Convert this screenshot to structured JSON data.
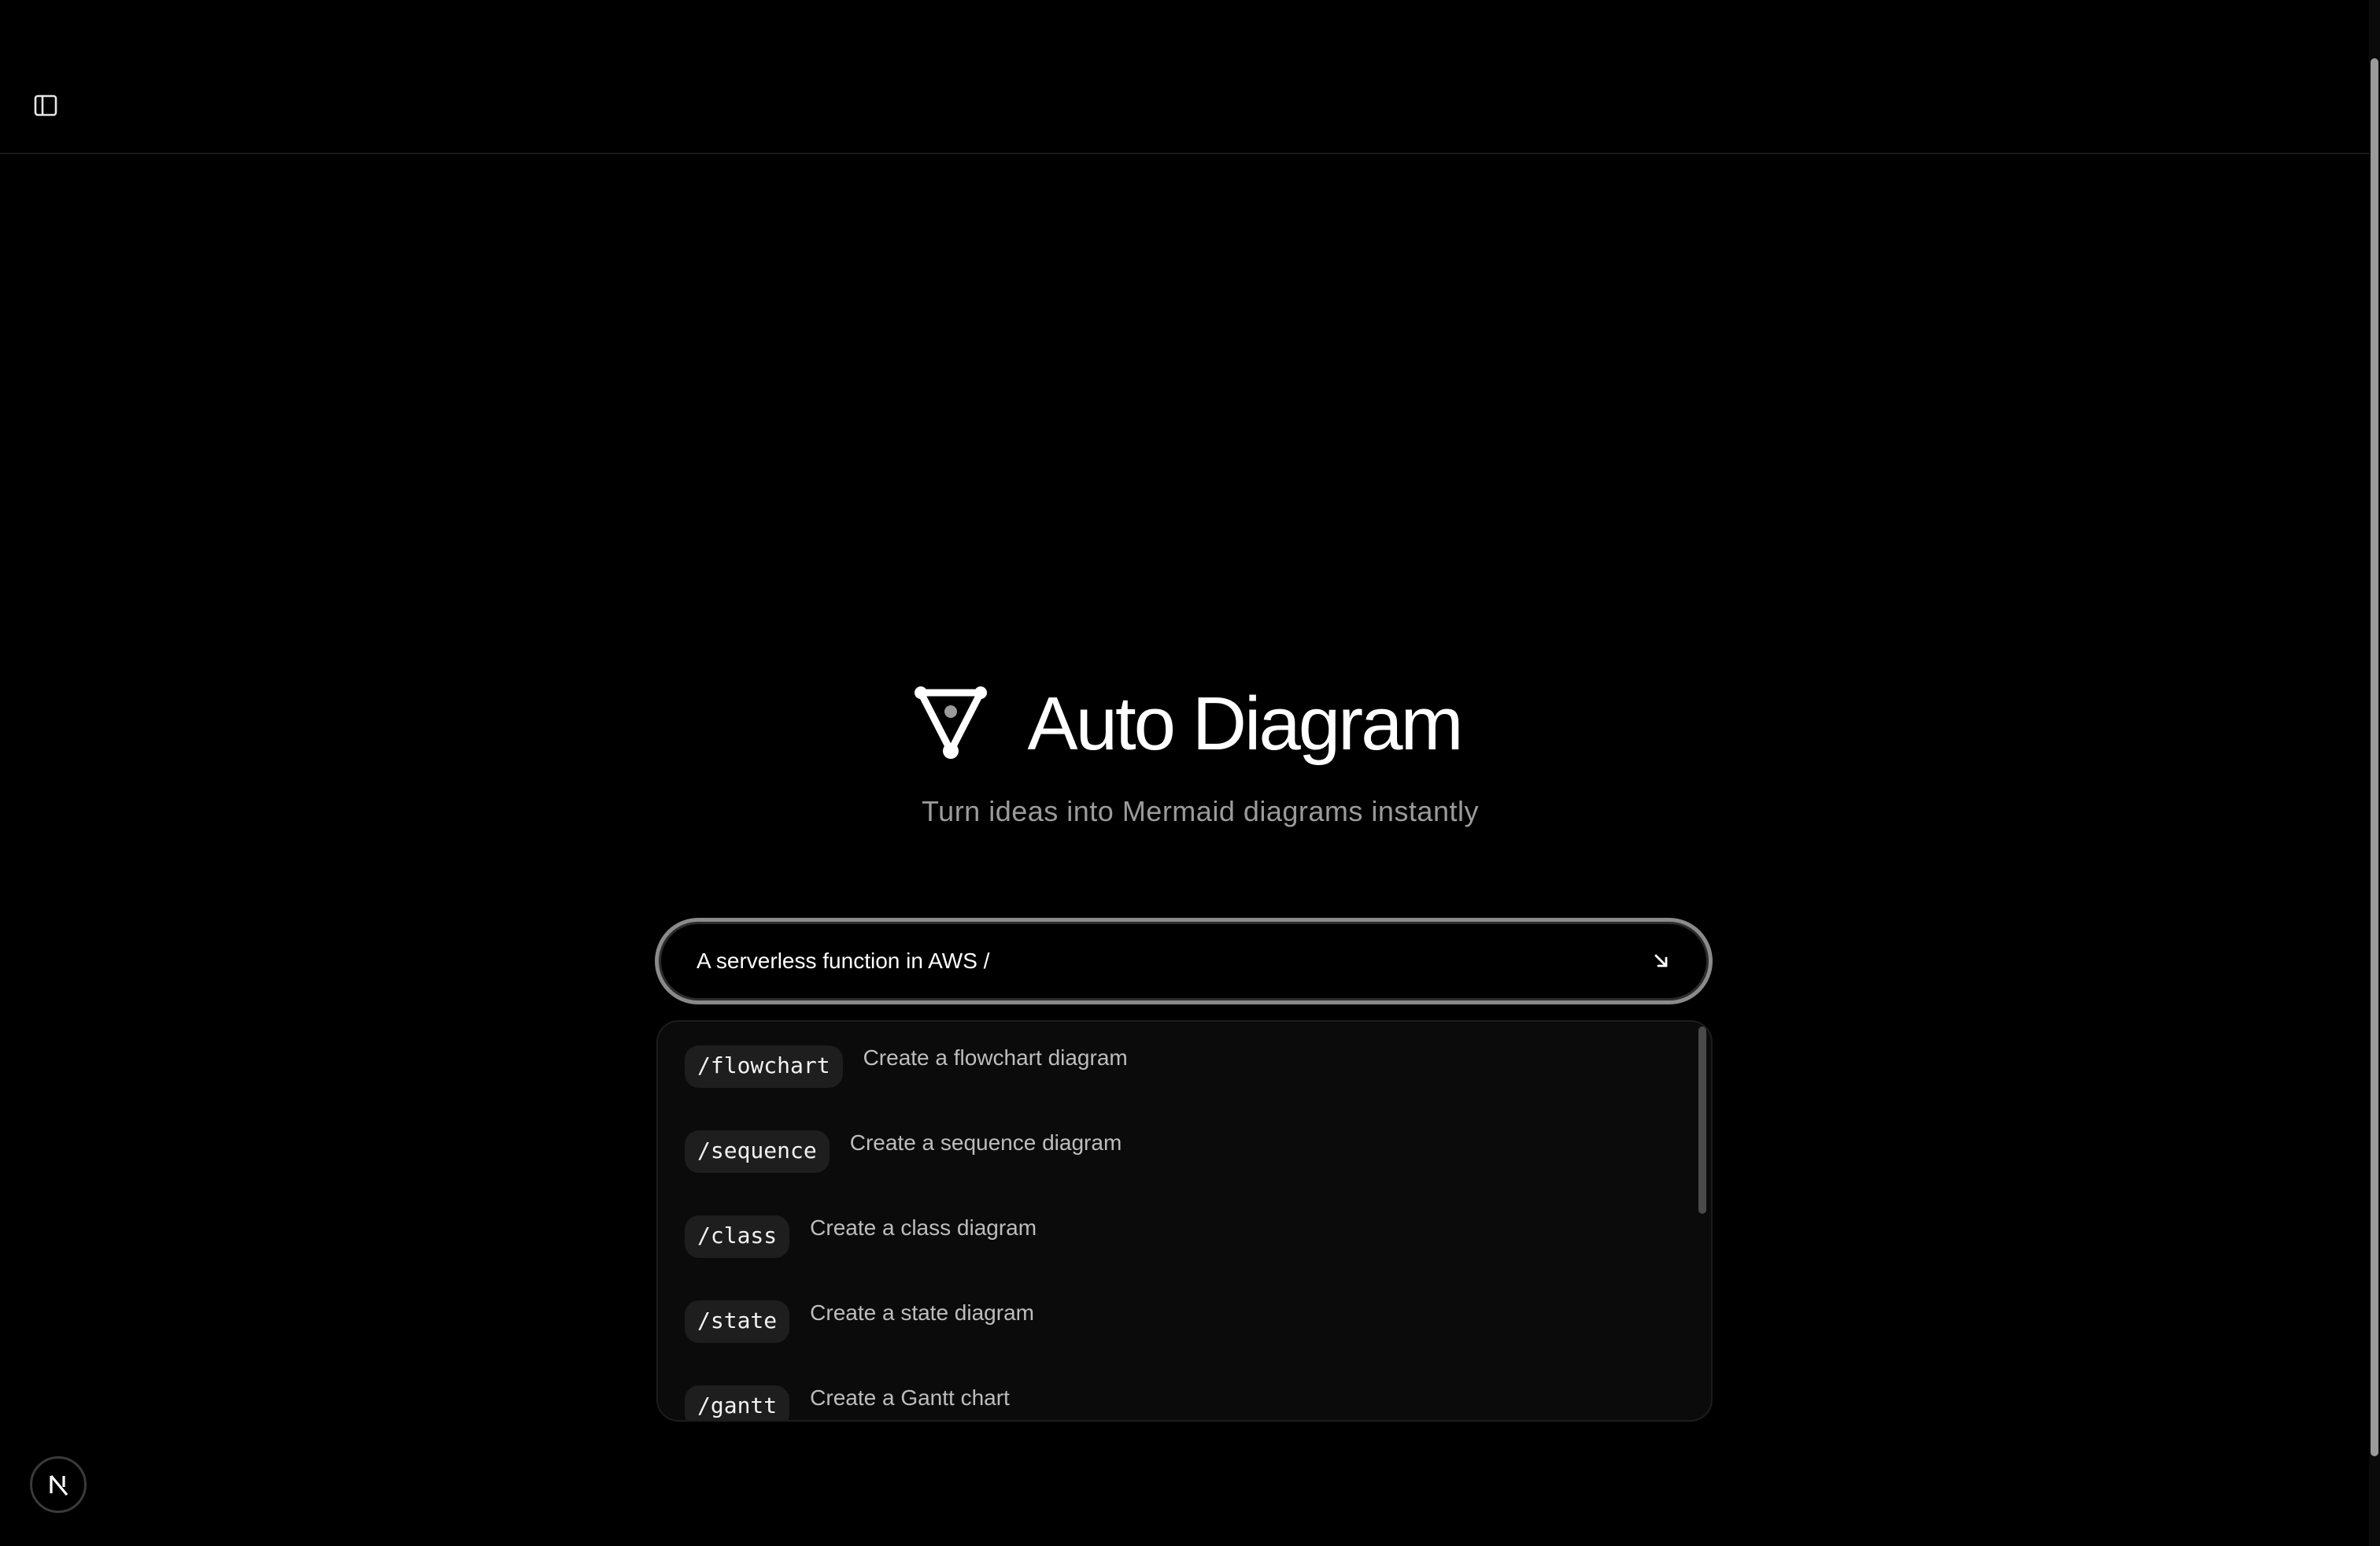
{
  "header": {
    "sidebar_toggle_icon": "sidebar-panel-icon"
  },
  "hero": {
    "logo_icon": "diagram-triangle-icon",
    "title": "Auto Diagram",
    "subtitle": "Turn ideas into Mermaid diagrams instantly"
  },
  "prompt": {
    "value": "A serverless function in AWS /",
    "submit_icon": "arrow-down-right-icon"
  },
  "commands": [
    {
      "command": "/flowchart",
      "description": "Create a flowchart diagram"
    },
    {
      "command": "/sequence",
      "description": "Create a sequence diagram"
    },
    {
      "command": "/class",
      "description": "Create a class diagram"
    },
    {
      "command": "/state",
      "description": "Create a state diagram"
    },
    {
      "command": "/gantt",
      "description": "Create a Gantt chart"
    }
  ],
  "footer": {
    "badge_letter": "N",
    "badge_icon": "nextjs-logo-icon"
  },
  "colors": {
    "background": "#000000",
    "text_primary": "#ffffff",
    "text_muted": "#9b9b9b",
    "menu_background": "#0b0b0b",
    "tag_background": "#1e1e1e",
    "prompt_border": "#8a8a8a"
  }
}
